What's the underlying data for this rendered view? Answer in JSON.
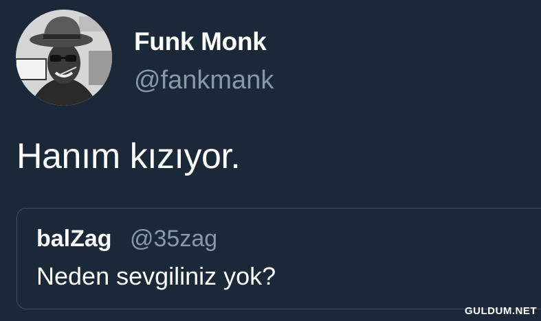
{
  "author": {
    "display_name": "Funk Monk",
    "handle": "@fankmank",
    "avatar_icon": "profile-photo"
  },
  "tweet": {
    "text": "Hanım kızıyor."
  },
  "quoted_tweet": {
    "display_name": "balZag",
    "handle": "@35zag",
    "text": "Neden sevgiliniz yok?"
  },
  "watermark": "GULDUM.NET",
  "colors": {
    "background": "#1b2838",
    "primary_text": "#ffffff",
    "secondary_text": "#8899a6",
    "card_border": "#3d4f60"
  }
}
